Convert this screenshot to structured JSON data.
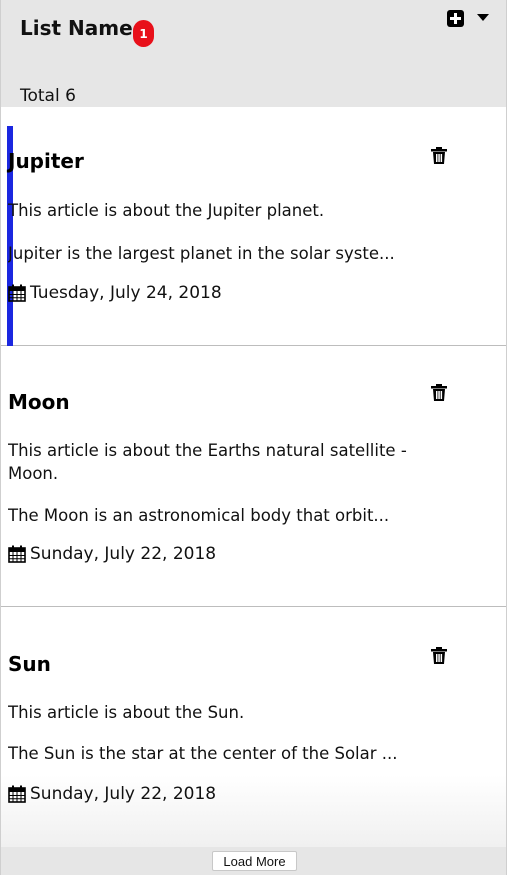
{
  "header": {
    "list_name": "List Name",
    "badge_count": "1",
    "total_label": "Total 6",
    "add_icon": "plus-square-icon",
    "menu_icon": "caret-down-icon"
  },
  "articles": [
    {
      "title": "Jupiter",
      "summary": "This article is about the Jupiter planet.",
      "excerpt": "Jupiter is the largest planet in the solar syste...",
      "date": "Tuesday, July 24, 2018",
      "selected": true
    },
    {
      "title": "Moon",
      "summary": "This article is about the Earths natural satellite - Moon.",
      "excerpt": "The Moon is an astronomical body that orbit...",
      "date": "Sunday, July 22, 2018",
      "selected": false
    },
    {
      "title": "Sun",
      "summary": "This article is about the Sun.",
      "excerpt": "The Sun is the star at the center of the Solar ...",
      "date": "Sunday, July 22, 2018",
      "selected": false
    }
  ],
  "footer": {
    "load_more_label": "Load More"
  },
  "colors": {
    "selected_accent": "#1b27e0",
    "badge": "#e8101a",
    "header_bg": "#e6e6e6"
  }
}
